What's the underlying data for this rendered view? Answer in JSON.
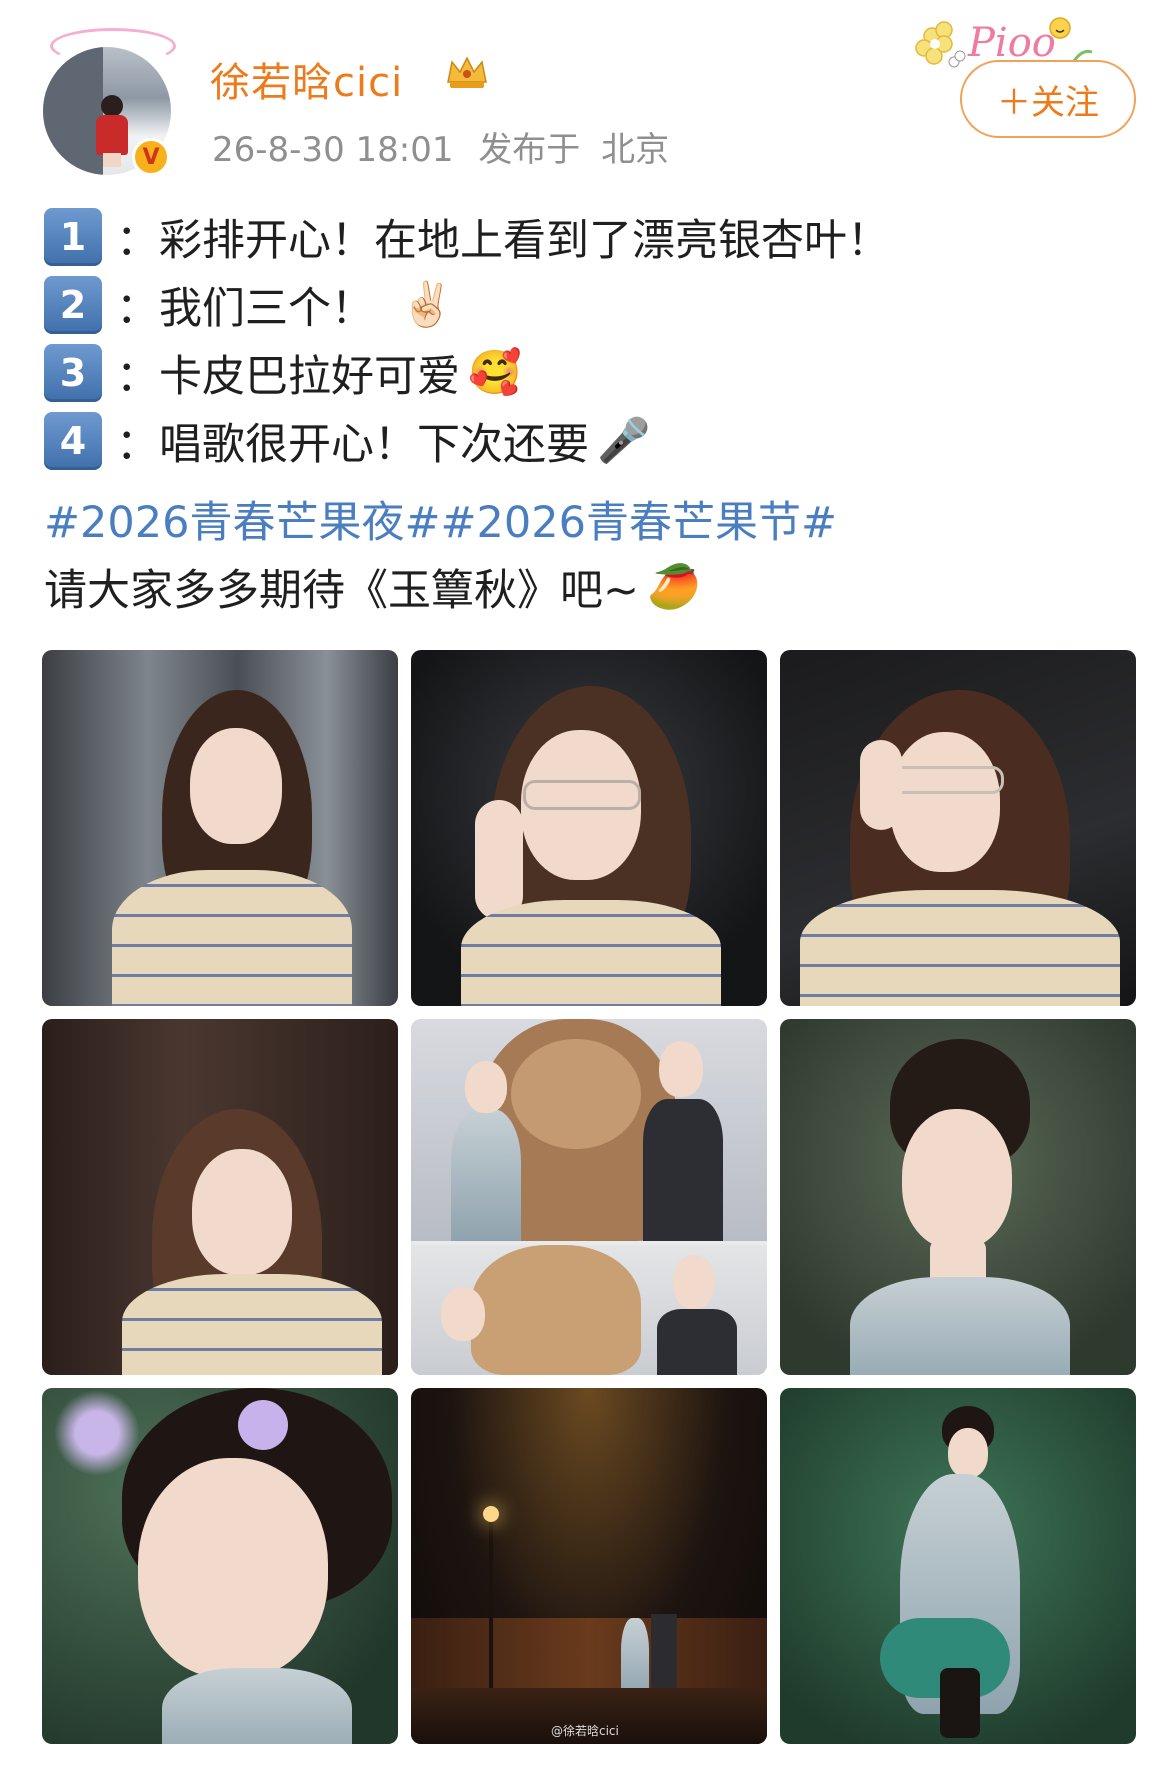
{
  "post": {
    "username": "徐若晗cici",
    "timestamp": "26-8-30 18:01",
    "location_prefix": "发布于",
    "location": "北京",
    "follow_label": "＋关注",
    "deco_text": "Pioo",
    "lines": [
      {
        "num": "1",
        "sep": "：",
        "text": "彩排开心！在地上看到了漂亮银杏叶！",
        "emoji": ""
      },
      {
        "num": "2",
        "sep": "：",
        "text": "我们三个！",
        "emoji": "✌🏻"
      },
      {
        "num": "3",
        "sep": "：",
        "text": "卡皮巴拉好可爱",
        "emoji": "🥰"
      },
      {
        "num": "4",
        "sep": "：",
        "text": "唱歌很开心！下次还要",
        "emoji": "🎤"
      }
    ],
    "hashtags": "#2026青春芒果夜##2026青春芒果节#",
    "closing_text": "请大家多多期待《玉簟秋》吧~",
    "closing_emoji": "🥭",
    "watermark": "@徐若晗cici"
  },
  "icons": {
    "verified": "verified-v-icon",
    "crown": "crown-badge-icon"
  },
  "colors": {
    "username": "#ee7b1b",
    "hashtag": "#4a7ec1",
    "follow_border": "#f1a256"
  }
}
